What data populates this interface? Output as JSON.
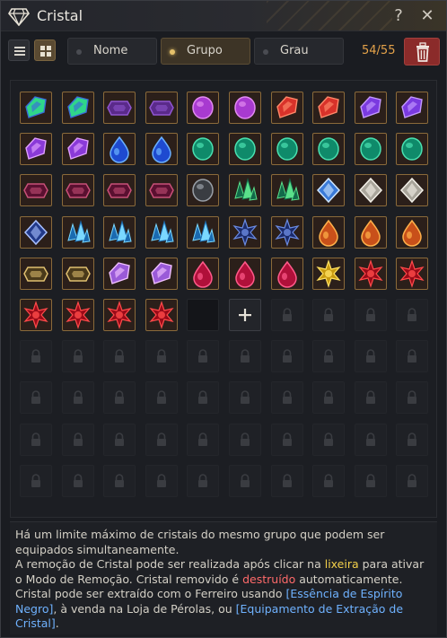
{
  "window": {
    "title": "Cristal"
  },
  "toolbar": {
    "sort_options": [
      {
        "label": "Nome",
        "active": false
      },
      {
        "label": "Grupo",
        "active": true
      },
      {
        "label": "Grau",
        "active": false
      }
    ],
    "count": "54/55"
  },
  "grid": {
    "columns": 10,
    "cells": [
      "green-blue",
      "green-blue",
      "violet-dark",
      "violet-dark",
      "magenta-round",
      "magenta-round",
      "red-shard",
      "red-shard",
      "violet-shard",
      "violet-shard",
      "purple-shard",
      "purple-shard",
      "blue-tear",
      "blue-tear",
      "teal-oval",
      "teal-oval",
      "teal-oval",
      "teal-oval",
      "teal-oval",
      "teal-oval",
      "darkred-shard",
      "darkred-shard",
      "darkred-shard",
      "darkred-shard",
      "gray-egg",
      "green-cluster",
      "green-cluster",
      "blue-diamond",
      "white-diamond",
      "white-diamond",
      "navy-diamond",
      "cyan-shards",
      "cyan-shards",
      "cyan-shards",
      "cyan-shards",
      "navy-burst",
      "navy-burst",
      "orange-drop",
      "orange-drop",
      "orange-drop",
      "gold-dark",
      "gold-dark",
      "lilac-gem",
      "lilac-gem",
      "crimson-drop",
      "crimson-drop",
      "crimson-drop",
      "gold-burst",
      "ruby-star",
      "ruby-star",
      "ruby-star",
      "ruby-star",
      "ruby-star",
      "ruby-star",
      "empty",
      "add",
      "locked",
      "locked",
      "locked",
      "locked",
      "locked",
      "locked",
      "locked",
      "locked",
      "locked",
      "locked",
      "locked",
      "locked",
      "locked",
      "locked",
      "locked",
      "locked",
      "locked",
      "locked",
      "locked",
      "locked",
      "locked",
      "locked",
      "locked",
      "locked",
      "locked",
      "locked",
      "locked",
      "locked",
      "locked",
      "locked",
      "locked",
      "locked",
      "locked",
      "locked",
      "locked",
      "locked",
      "locked",
      "locked",
      "locked",
      "locked",
      "locked",
      "locked",
      "locked",
      "locked"
    ]
  },
  "gem_colors": {
    "green-blue": [
      "#2fd68a",
      "#3a6bd8"
    ],
    "violet-dark": [
      "#5a2a8a",
      "#8f55d0"
    ],
    "magenta-round": [
      "#a83ad0",
      "#e18af0"
    ],
    "red-shard": [
      "#d8322a",
      "#ff8a6a"
    ],
    "violet-shard": [
      "#7a3ae0",
      "#c49aff"
    ],
    "purple-shard": [
      "#8a3ad8",
      "#e0a0ff"
    ],
    "blue-tear": [
      "#1e4ad0",
      "#6ab0ff"
    ],
    "teal-oval": [
      "#0f8a6a",
      "#4ae0b0"
    ],
    "darkred-shard": [
      "#5a1030",
      "#c85078"
    ],
    "gray-egg": [
      "#3a3d42",
      "#9aa0a8"
    ],
    "green-cluster": [
      "#126a4a",
      "#5ae08a"
    ],
    "blue-diamond": [
      "#3a7ad8",
      "#cfe6ff"
    ],
    "white-diamond": [
      "#a8a49a",
      "#f5f2ea"
    ],
    "navy-diamond": [
      "#223a8a",
      "#a8c0ff"
    ],
    "cyan-shards": [
      "#1a6ab0",
      "#7ad8ff"
    ],
    "navy-burst": [
      "#1a2a6a",
      "#6a8ae0"
    ],
    "orange-drop": [
      "#c8501a",
      "#ffb04a"
    ],
    "gold-dark": [
      "#4a3a1a",
      "#e0c070"
    ],
    "lilac-gem": [
      "#9a5ad8",
      "#f0c0ff"
    ],
    "crimson-drop": [
      "#b0103a",
      "#ff5a8a"
    ],
    "gold-burst": [
      "#c89a10",
      "#ffe060"
    ],
    "ruby-star": [
      "#9a0a18",
      "#ff4a4a"
    ]
  },
  "info": {
    "line1": "Há um limite máximo de cristais do mesmo grupo que podem ser equipados simultaneamente.",
    "line2_a": "A remoção de Cristal pode ser realizada após clicar na ",
    "line2_hl": "lixeira",
    "line2_b": " para ativar o Modo de Remoção. Cristal removido é ",
    "line2_red": "destruído",
    "line2_c": " automaticamente.",
    "line3_a": "Cristal pode ser extraído com o Ferreiro usando ",
    "line3_hl1": "[Essência de Espírito Negro]",
    "line3_b": ", à venda na Loja de Pérolas, ou ",
    "line3_hl2": "[Equipamento de Extração de Cristal]",
    "line3_c": "."
  }
}
